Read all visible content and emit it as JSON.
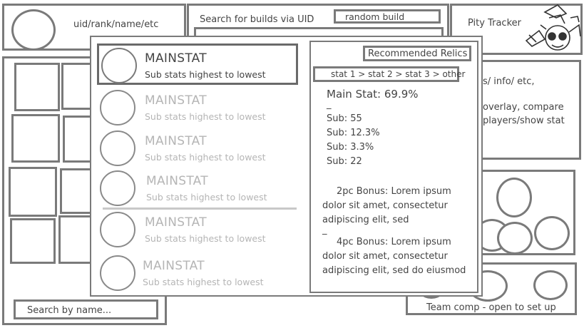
{
  "header": {
    "profile_text": "uid/rank/name/etc",
    "search_label": "Search for builds via UID",
    "random_build": "random build",
    "pity_tracker": "Pity Tracker"
  },
  "info_panel": {
    "line1": "s/ info/ etc,",
    "line2": "overlay, compare",
    "line3": "players/show stat"
  },
  "left_search": {
    "placeholder": "Search by name..."
  },
  "team_comp": {
    "label": "Team comp - open to set up"
  },
  "relic_overlay": {
    "slots": [
      {
        "mainstat": "MAINSTAT",
        "substats": "Sub stats highest to lowest"
      },
      {
        "mainstat": "MAINSTAT",
        "substats": "Sub stats highest to lowest"
      },
      {
        "mainstat": "MAINSTAT",
        "substats": "Sub stats highest to lowest"
      },
      {
        "mainstat": "MAINSTAT",
        "substats": "Sub stats highest to lowest"
      },
      {
        "mainstat": "MAINSTAT",
        "substats": "Sub stats highest to lowest"
      },
      {
        "mainstat": "MAINSTAT",
        "substats": "Sub stats highest to lowest"
      }
    ],
    "recommended_title": "Recommended Relics",
    "stat_priority": "stat 1 > stat 2 > stat 3 > other",
    "main_stat": "Main Stat: 69.9%",
    "dash1": "_",
    "subs": [
      "Sub: 55",
      "Sub: 12.3%",
      "Sub: 3.3%",
      "Sub: 22"
    ],
    "bonus_2pc": "2pc Bonus: Lorem ipsum dolor sit amet, consectetur adipiscing elit, sed",
    "dash2": "_",
    "bonus_4pc": "4pc Bonus: Lorem ipsum dolor sit amet, consectetur adipiscing elit, sed do eiusmod"
  },
  "colors": {
    "stroke": "#7a7a7a",
    "faded_text": "#b5b5b5",
    "text": "#444444"
  }
}
